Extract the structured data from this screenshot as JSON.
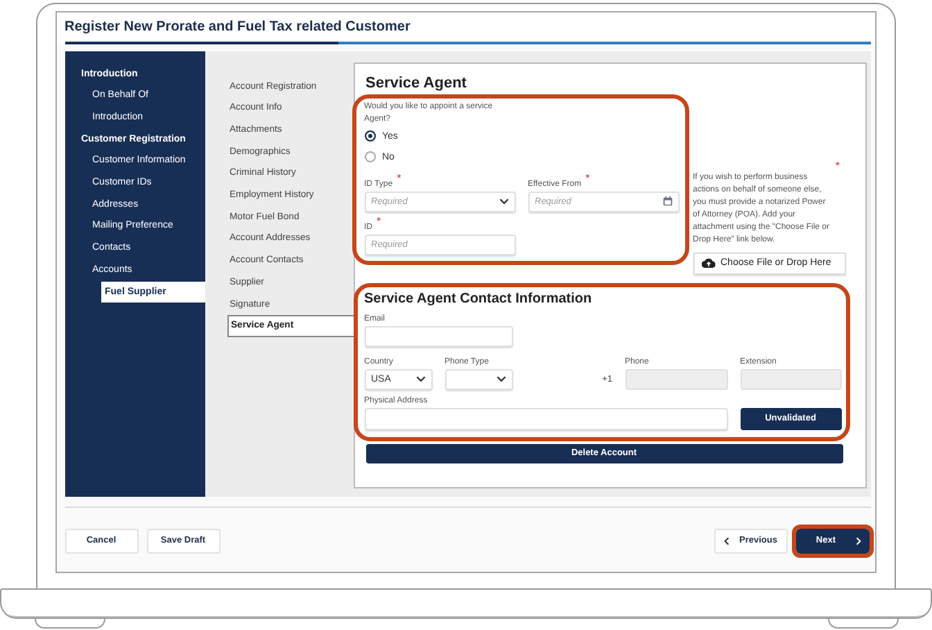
{
  "window": {
    "title": "Register New Prorate and Fuel Tax related Customer",
    "progress": {
      "level": 0.34
    }
  },
  "sidebar": {
    "items": [
      {
        "label": "Introduction",
        "selected": false,
        "children": [
          {
            "label": "On Behalf Of",
            "selected": false
          },
          {
            "label": "Introduction",
            "selected": false
          }
        ]
      },
      {
        "label": "Customer Registration",
        "selected": false,
        "children": [
          {
            "label": "Customer Information",
            "selected": false
          },
          {
            "label": "Customer IDs",
            "selected": false
          },
          {
            "label": "Addresses",
            "selected": false
          },
          {
            "label": "Mailing Preference",
            "selected": false
          },
          {
            "label": "Contacts",
            "selected": false
          },
          {
            "label": "Accounts",
            "selected": false,
            "children": [
              {
                "label": "Fuel Supplier",
                "selected": true
              }
            ]
          }
        ]
      }
    ]
  },
  "section_nav": {
    "items": [
      {
        "label": "Account Registration",
        "selected": false
      },
      {
        "label": "Account Info",
        "selected": false
      },
      {
        "label": "Attachments",
        "selected": false
      },
      {
        "label": "Demographics",
        "selected": false
      },
      {
        "label": "Criminal History",
        "selected": false
      },
      {
        "label": "Employment History",
        "selected": false
      },
      {
        "label": "Motor Fuel Bond",
        "selected": false
      },
      {
        "label": "Account Addresses",
        "selected": false
      },
      {
        "label": "Account Contacts",
        "selected": false
      },
      {
        "label": "Supplier",
        "selected": false
      },
      {
        "label": "Signature",
        "selected": false
      },
      {
        "label": "Service Agent",
        "selected": true
      }
    ]
  },
  "service_agent": {
    "title": "Service Agent",
    "highlighted": true,
    "question": "Would you like to appoint a service Agent?",
    "options": [
      {
        "label": "Yes",
        "selected": true
      },
      {
        "label": "No",
        "selected": false
      }
    ],
    "fields": [
      {
        "label": "ID Type",
        "kind": "select",
        "required_mark": "*",
        "placeholder": "Required"
      },
      {
        "label": "Effective From",
        "kind": "date",
        "required_mark": "*",
        "placeholder": "Required"
      },
      {
        "label": "ID",
        "kind": "text",
        "required_mark": "*",
        "placeholder": "Required"
      }
    ],
    "notice": "If you wish to perform business actions on behalf of someone else, you must provide a notarized Power of Attorney (POA). Add your attachment using the \"Choose File or Drop Here\" link below.",
    "notice_required_mark": "*",
    "upload_button": "Choose File or Drop Here"
  },
  "contact": {
    "title": "Service Agent Contact Information",
    "highlighted": true,
    "email": {
      "label": "Email"
    },
    "country": {
      "label": "Country",
      "value": "USA"
    },
    "phone_type": {
      "label": "Phone Type"
    },
    "phone_prefix": "+1",
    "phone": {
      "label": "Phone",
      "disabled": true
    },
    "extension": {
      "label": "Extension",
      "disabled": true
    },
    "address": {
      "label": "Physical Address"
    },
    "validate_button": "Unvalidated"
  },
  "delete_button": "Delete Account",
  "footer": {
    "cancel": "Cancel",
    "save_draft": "Save Draft",
    "previous": "Previous",
    "next": {
      "label": "Next",
      "highlighted": true
    }
  }
}
